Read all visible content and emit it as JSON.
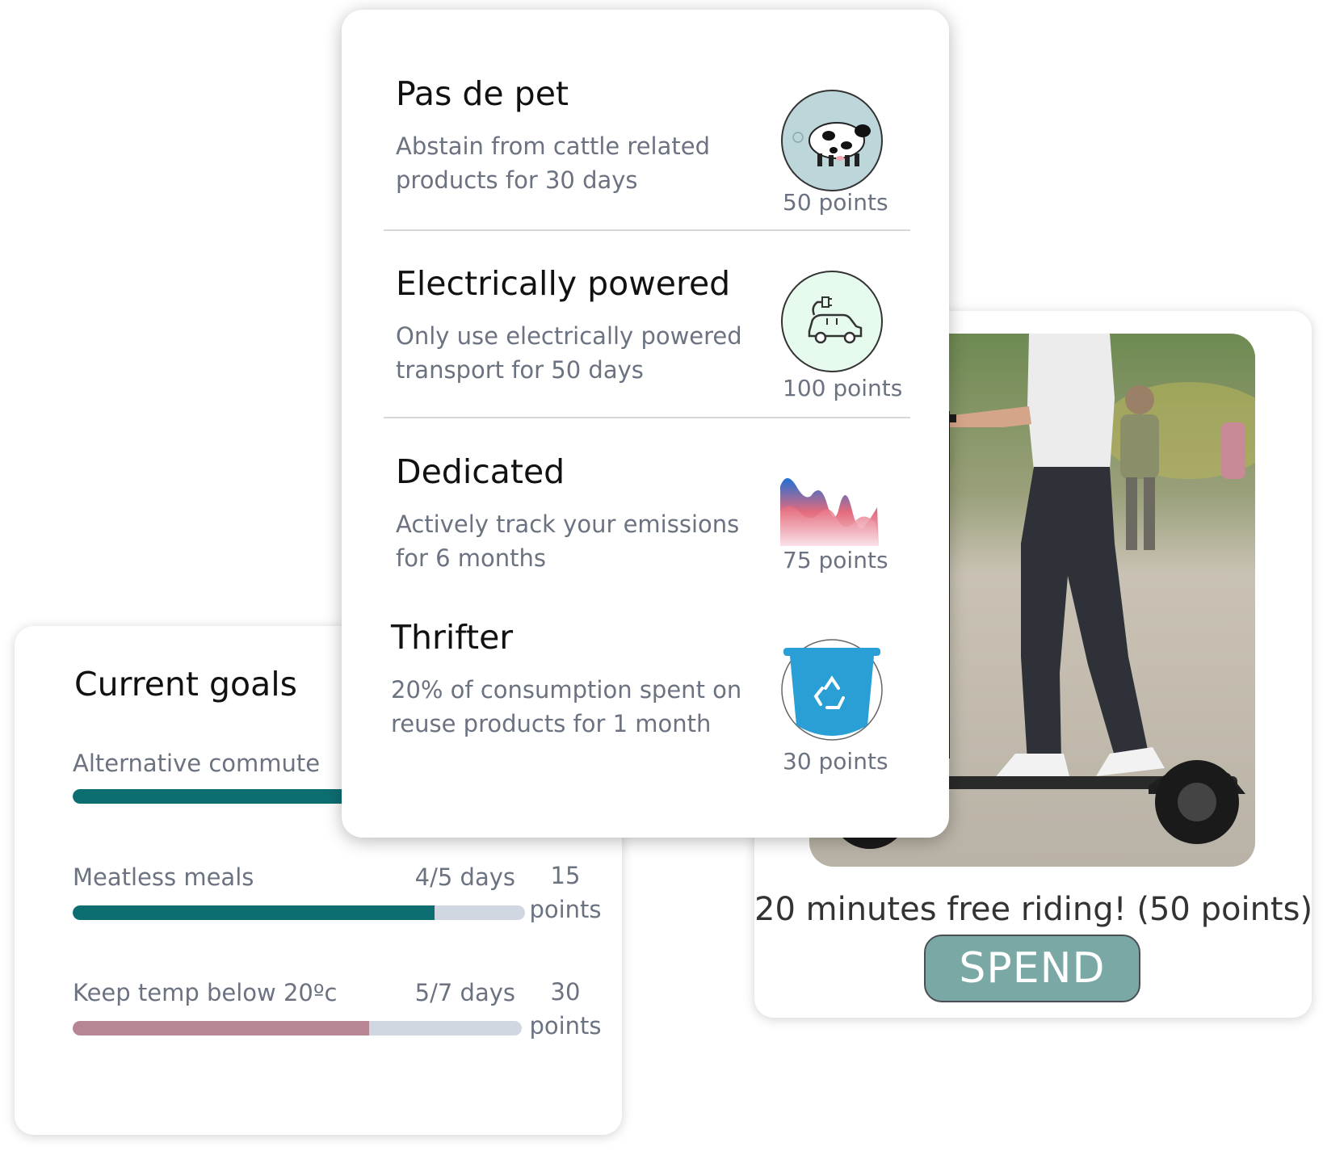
{
  "goals": {
    "title": "Current goals",
    "items": [
      {
        "label": "Alternative commute",
        "days": "",
        "progress": 0.6,
        "fill_color": "#0d6e72",
        "points_value": "",
        "points_unit": ""
      },
      {
        "label": "Meatless meals",
        "days": "4/5 days",
        "progress": 0.8,
        "fill_color": "#0d6e72",
        "points_value": "15",
        "points_unit": "points"
      },
      {
        "label": "Keep temp below 20ºc",
        "days": "5/7 days",
        "progress": 0.66,
        "fill_color": "#b78692",
        "points_value": "30",
        "points_unit": "points"
      }
    ],
    "track_color": "#d0d7e1"
  },
  "reward": {
    "text": "20 minutes free riding! (50 points)",
    "button": "SPEND",
    "button_color": "#7aa8a5"
  },
  "challenges": [
    {
      "title": "Pas de pet",
      "desc_line1": "Abstain from cattle related",
      "desc_line2": "products for 30 days",
      "points": "50 points",
      "icon": "cow-icon"
    },
    {
      "title": "Electrically powered",
      "desc_line1": "Only use electrically powered",
      "desc_line2": "transport for 50 days",
      "points": "100 points",
      "icon": "electric-car-icon"
    },
    {
      "title": "Dedicated",
      "desc_line1": "Actively track your emissions",
      "desc_line2": "for 6 months",
      "points": "75 points",
      "icon": "emissions-chart-icon"
    },
    {
      "title": "Thrifter",
      "desc_line1": "20% of consumption spent on",
      "desc_line2": "reuse products for 1 month",
      "points": "30 points",
      "icon": "recycle-bin-icon"
    }
  ]
}
